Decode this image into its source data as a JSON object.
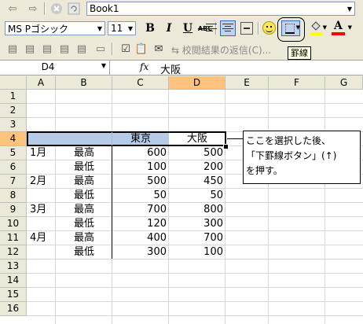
{
  "toolbar1": {
    "workbook_name": "Book1"
  },
  "toolbar2": {
    "font_name": "MS Pゴシック",
    "font_size": "11",
    "bold_label": "B",
    "italic_label": "I",
    "underline_label": "U",
    "strike_label": "ABC",
    "fill_color": "#ffff00",
    "font_color": "#ff0000",
    "borders_tooltip": "罫線"
  },
  "toolbar3": {
    "reply_label": "校閲結果の返信(C)..."
  },
  "formula_bar": {
    "name_box": "D4",
    "fx_label": "fx",
    "value": "大阪"
  },
  "columns": [
    "A",
    "B",
    "C",
    "D",
    "E",
    "F",
    "G"
  ],
  "rows": [
    "1",
    "2",
    "3",
    "4",
    "5",
    "6",
    "7",
    "8",
    "9",
    "10",
    "11",
    "12",
    "13",
    "14",
    "15",
    "16"
  ],
  "cells": {
    "C4": "東京",
    "D4": "大阪",
    "A5": "1月",
    "B5": "最高",
    "C5": "600",
    "D5": "500",
    "B6": "最低",
    "C6": "100",
    "D6": "200",
    "A7": "2月",
    "B7": "最高",
    "C7": "500",
    "D7": "450",
    "B8": "最低",
    "C8": "50",
    "D8": "50",
    "A9": "3月",
    "B9": "最高",
    "C9": "700",
    "D9": "800",
    "B10": "最低",
    "C10": "120",
    "D10": "300",
    "A11": "4月",
    "B11": "最高",
    "C11": "400",
    "D11": "700",
    "B12": "最低",
    "C12": "300",
    "D12": "100"
  },
  "callout": {
    "line1": "ここを選択した後、",
    "line2": "「下罫線ボタン」(↑)",
    "line3": "を押す。"
  }
}
